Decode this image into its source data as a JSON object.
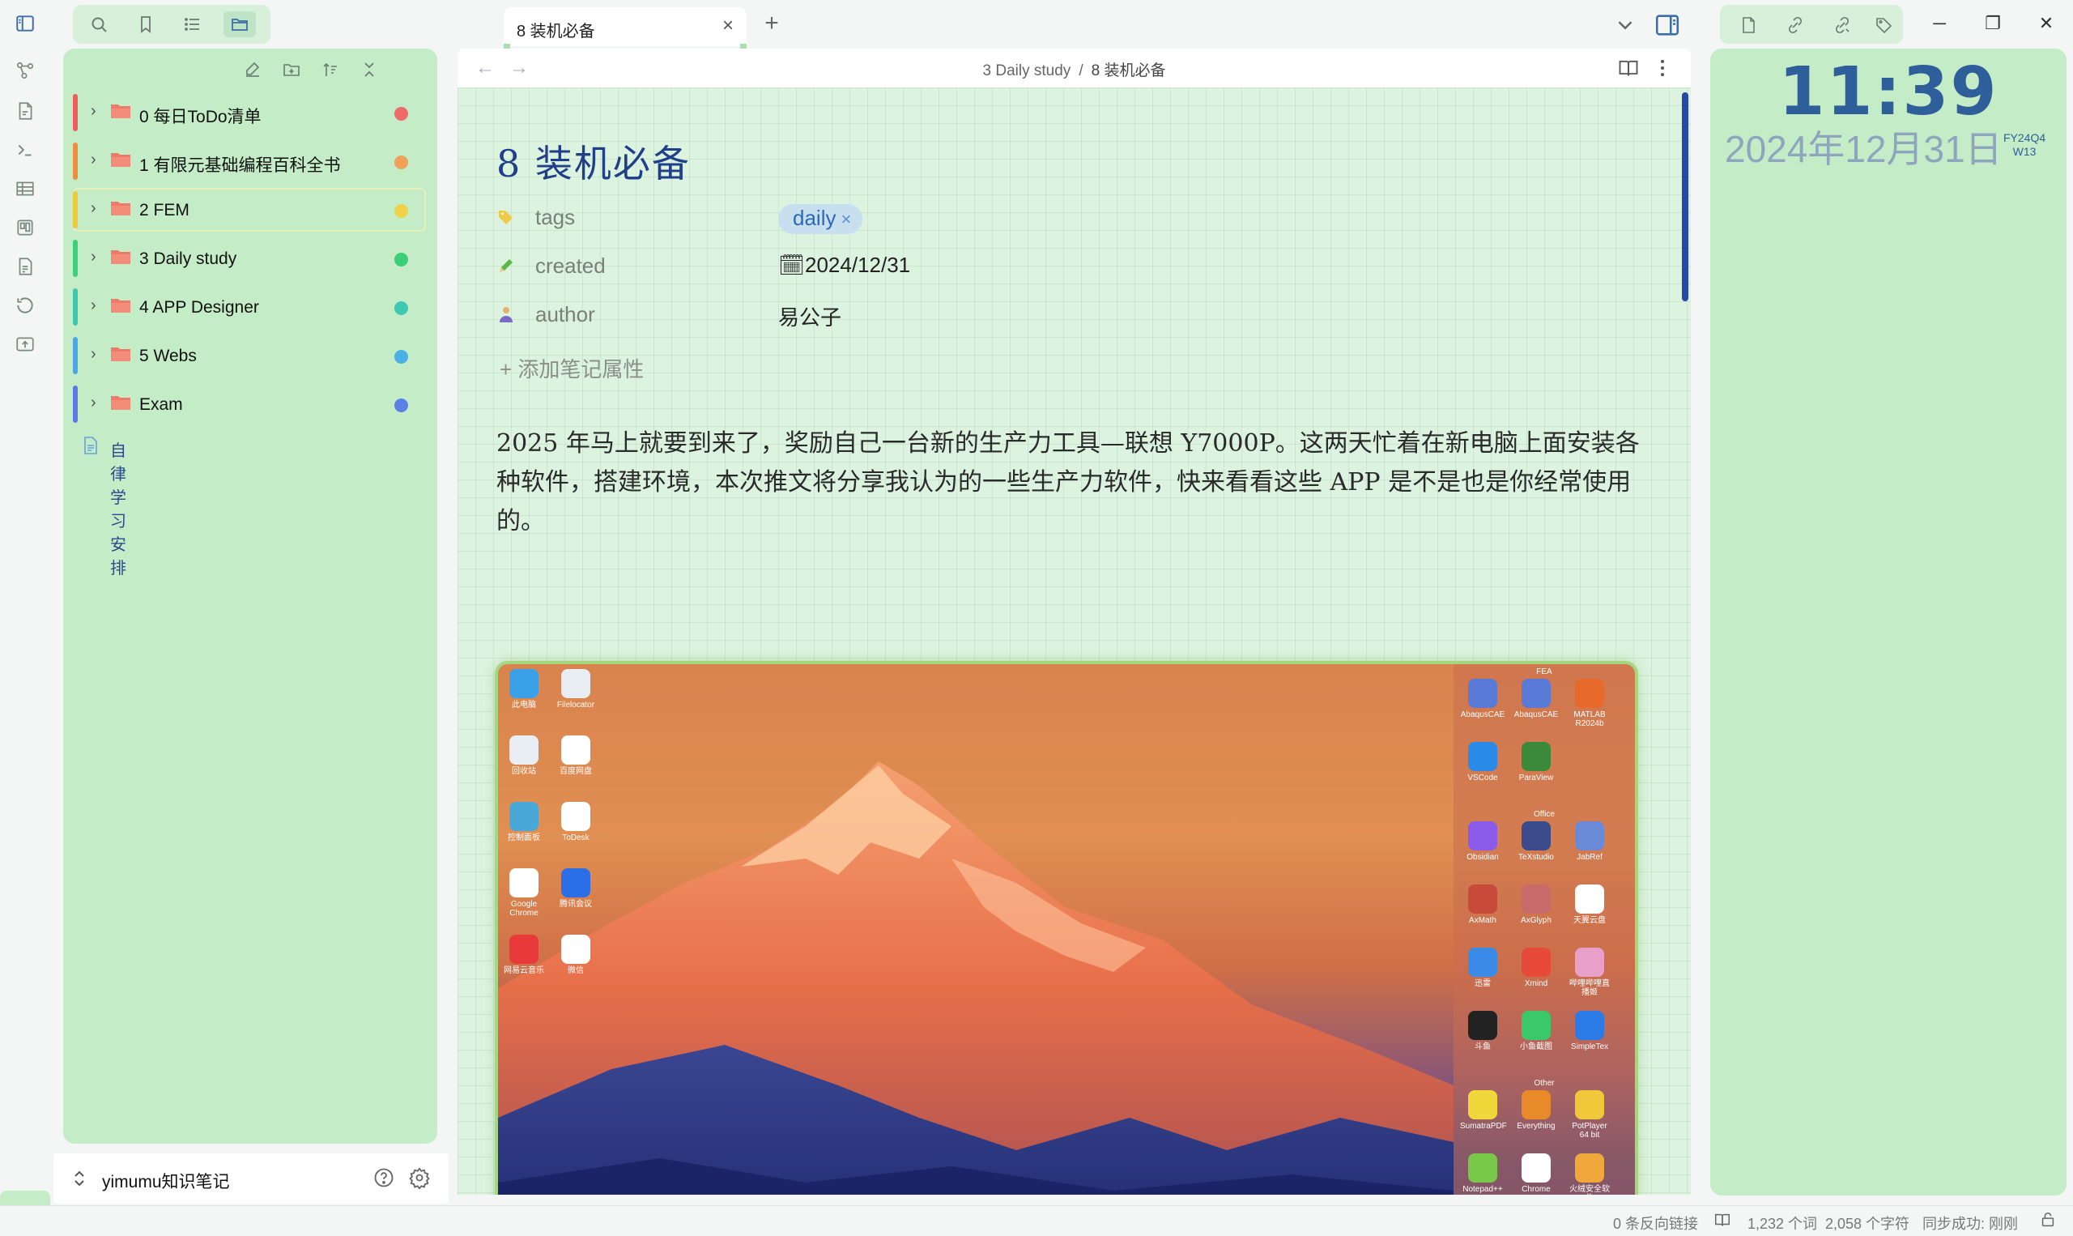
{
  "tab": {
    "title": "8 装机必备"
  },
  "breadcrumb": {
    "parent": "3 Daily study",
    "sep": "/",
    "current": "8 装机必备"
  },
  "explorer": {
    "folders": [
      {
        "name": "0 每日ToDo清单",
        "accent": "#f05a5a",
        "dot": "#ef6a6a"
      },
      {
        "name": "1 有限元基础编程百科全书",
        "accent": "#f08c3c",
        "dot": "#f0a05a"
      },
      {
        "name": "2 FEM",
        "accent": "#f0c93c",
        "dot": "#f0d24a"
      },
      {
        "name": "3 Daily study",
        "accent": "#3cd07a",
        "dot": "#3ccf78"
      },
      {
        "name": "4 APP Designer",
        "accent": "#3cc8b0",
        "dot": "#3ccab2"
      },
      {
        "name": "5 Webs",
        "accent": "#4aa8e8",
        "dot": "#4ab0e8"
      },
      {
        "name": "Exam",
        "accent": "#5a7ae8",
        "dot": "#5a80e8"
      }
    ],
    "file": "自律学习安排"
  },
  "vault": {
    "name": "yimumu知识笔记"
  },
  "note": {
    "title": "8  装机必备",
    "properties": {
      "tags": {
        "name": "tags",
        "value": "daily",
        "remove": "×"
      },
      "created": {
        "name": "created",
        "value": "2024/12/31"
      },
      "author": {
        "name": "author",
        "value": "易公子"
      }
    },
    "add_property": "+ 添加笔记属性",
    "paragraph": "2025 年马上就要到来了，奖励自己一台新的生产力工具—联想 Y7000P。这两天忙着在新电脑上面安装各种软件，搭建环境，本次推文将分享我认为的一些生产力软件，快来看看这些 APP 是不是也是你经常使用的。"
  },
  "desktop": {
    "left_icons": [
      {
        "label": "此电脑",
        "color": "#3aa0e8"
      },
      {
        "label": "Filelocator",
        "color": "#e8eef4"
      },
      {
        "label": "回收站",
        "color": "#e8eef4"
      },
      {
        "label": "百度网盘",
        "color": "#ffffff"
      },
      {
        "label": "控制面板",
        "color": "#4aa8d8"
      },
      {
        "label": "ToDesk",
        "color": "#ffffff"
      },
      {
        "label": "Google Chrome",
        "color": "#ffffff"
      },
      {
        "label": "腾讯会议",
        "color": "#2b6fe8"
      },
      {
        "label": "网易云音乐",
        "color": "#e83a3a"
      },
      {
        "label": "微信",
        "color": "#ffffff"
      }
    ],
    "dock_groups": [
      {
        "title": "FEA",
        "items": [
          {
            "label": "AbaqusCAE",
            "color": "#5a7ad8"
          },
          {
            "label": "AbaqusCAE",
            "color": "#5a7ad8"
          },
          {
            "label": "MATLAB R2024b",
            "color": "#e86a2a"
          },
          {
            "label": "VSCode",
            "color": "#2a8ae8"
          },
          {
            "label": "ParaView",
            "color": "#3a8a3a"
          }
        ]
      },
      {
        "title": "Office",
        "items": [
          {
            "label": "Obsidian",
            "color": "#8a5ae8"
          },
          {
            "label": "TeXstudio",
            "color": "#3a4a8a"
          },
          {
            "label": "JabRef",
            "color": "#6a8ad8"
          },
          {
            "label": "AxMath",
            "color": "#c84a3a"
          },
          {
            "label": "AxGlyph",
            "color": "#c86a6a"
          },
          {
            "label": "天翼云盘",
            "color": "#ffffff"
          },
          {
            "label": "迅雷",
            "color": "#3a8ae8"
          },
          {
            "label": "Xmind",
            "color": "#e84a3a"
          },
          {
            "label": "哔哩哔哩直播姬",
            "color": "#e8a0c8"
          },
          {
            "label": "斗鱼",
            "color": "#222222"
          },
          {
            "label": "小鱼截图",
            "color": "#3ac86a"
          },
          {
            "label": "SimpleTex",
            "color": "#2a7ae8"
          }
        ]
      },
      {
        "title": "Other",
        "items": [
          {
            "label": "SumatraPDF",
            "color": "#f0d83a"
          },
          {
            "label": "Everything",
            "color": "#e88a2a"
          },
          {
            "label": "PotPlayer 64 bit",
            "color": "#f0c83a"
          },
          {
            "label": "Notepad++",
            "color": "#7ac84a"
          },
          {
            "label": "Chrome",
            "color": "#ffffff"
          },
          {
            "label": "火绒安全软件",
            "color": "#f0a83a"
          }
        ]
      }
    ]
  },
  "clock": {
    "time": "11:39",
    "date": "2024年12月31日",
    "fy": "FY24Q4",
    "week": "W13"
  },
  "status": {
    "backlinks": "0 条反向链接",
    "words": "1,232 个词",
    "chars": "2,058 个字符",
    "sync": "同步成功: 刚刚"
  }
}
